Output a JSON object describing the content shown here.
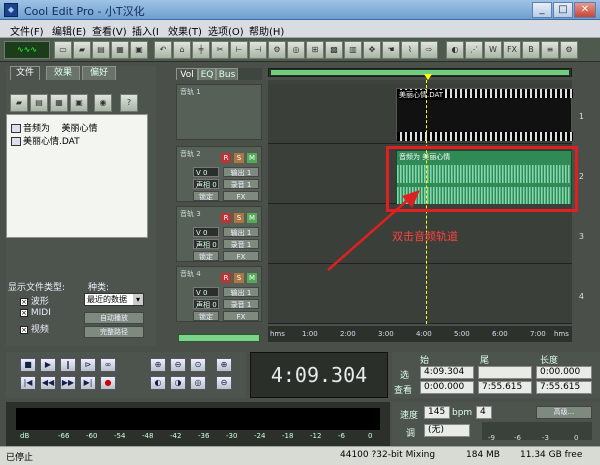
{
  "window": {
    "title": "Cool Edit Pro  - 小T汉化",
    "buttons": [
      "_",
      "□",
      "✕"
    ]
  },
  "menu": [
    "文件(F)",
    "编辑(E)",
    "查看(V)",
    "插入(I",
    "效果(T)",
    "选项(O)",
    "帮助(H)"
  ],
  "left_panel": {
    "tabs": [
      "文件",
      "效果",
      "偏好"
    ],
    "files": [
      {
        "name": "音频为",
        "detail": "美丽心情"
      },
      {
        "name": "美丽心情.DAT",
        "detail": ""
      }
    ],
    "show_type_label": "显示文件类型:",
    "kind_label": "种类:",
    "types": [
      "波形",
      "MIDI",
      "视频"
    ],
    "sort_value": "最近的数据",
    "auto_play": "自动播放",
    "full_path": "完整路径"
  },
  "track_tabs": [
    "Vol",
    "EQ",
    "Bus"
  ],
  "tracks": [
    {
      "name": "音轨 1",
      "vol": "",
      "pan": "",
      "out": "",
      "rec": "",
      "lock": "",
      "fx": ""
    },
    {
      "name": "音轨 2",
      "vol": "V 0",
      "pan": "声相 0",
      "out": "输出 1",
      "rec": "录音 1",
      "lock": "锁定",
      "fx": "FX"
    },
    {
      "name": "音轨 3",
      "vol": "V 0",
      "pan": "声相 0",
      "out": "输出 1",
      "rec": "录音 1",
      "lock": "锁定",
      "fx": "FX"
    },
    {
      "name": "音轨 4",
      "vol": "V 0",
      "pan": "声相 0",
      "out": "输出 1",
      "rec": "录音 1",
      "lock": "锁定",
      "fx": "FX"
    }
  ],
  "clips": [
    {
      "label": "美丽心情.DAT"
    },
    {
      "label": "音频为    美丽心情"
    }
  ],
  "annotation": "双击音频轨道",
  "lane_numbers": [
    "1",
    "2",
    "3",
    "4"
  ],
  "ruler": [
    "hms",
    "1:00",
    "2:00",
    "3:00",
    "4:00",
    "5:00",
    "6:00",
    "7:00",
    "hms"
  ],
  "time_display": "4:09.304",
  "selection": {
    "headers": [
      "始",
      "尾",
      "长度"
    ],
    "sel_label": "选",
    "view_label": "查看",
    "sel": [
      "4:09.304",
      "",
      "0:00.000"
    ],
    "view": [
      "0:00.000",
      "7:55.615",
      "7:55.615"
    ]
  },
  "tempo": {
    "speed_label": "速度",
    "speed": "145",
    "bpm": "bpm",
    "beats": "4",
    "key_label": "调",
    "key": "(无)",
    "advanced": "高级..."
  },
  "meter_ticks": [
    "dB",
    "-66",
    "-60",
    "-54",
    "-48",
    "-42",
    "-36",
    "-30",
    "-24",
    "-18",
    "-12",
    "-6",
    "0"
  ],
  "status": {
    "left": "已停止",
    "format": "44100 ?32-bit Mixing",
    "mem": "184 MB",
    "free": "11.34 GB free"
  }
}
